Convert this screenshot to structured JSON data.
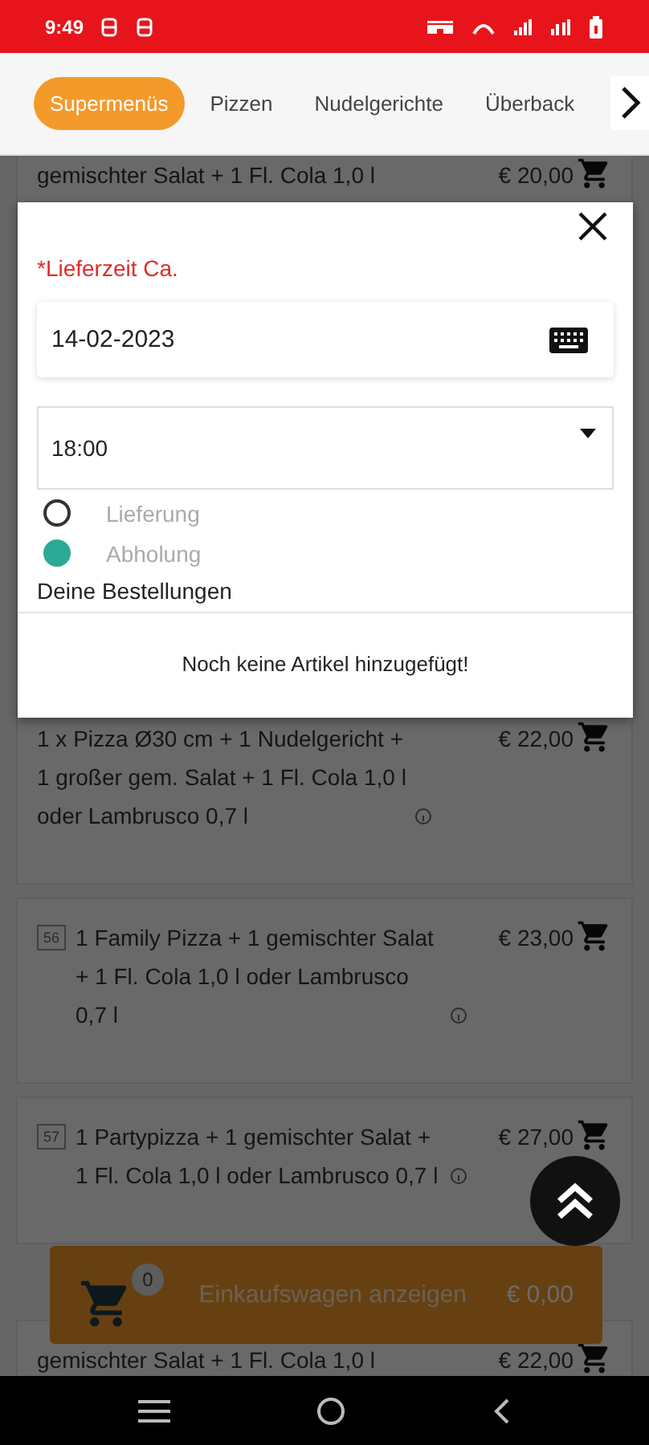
{
  "status_bar": {
    "time": "9:49"
  },
  "tabs": [
    {
      "label": "Supermenüs",
      "selected": true
    },
    {
      "label": "Pizzen",
      "selected": false
    },
    {
      "label": "Nudelgerichte",
      "selected": false
    },
    {
      "label": "Überback",
      "selected": false
    }
  ],
  "menu_items": [
    {
      "description": "gemischter Salat + 1 Fl. Cola 1,0 l",
      "price": "€ 20,00"
    },
    {
      "description": "1 x Pizza Ø30 cm + 1 Nudelgericht + 1 großer gem. Salat + 1 Fl. Cola 1,0 l oder Lambrusco 0,7 l",
      "price": "€ 22,00",
      "info": true
    },
    {
      "number": "56",
      "description": "1 Family Pizza + 1 gemischter Salat + 1 Fl. Cola 1,0 l oder Lambrusco 0,7 l",
      "price": "€ 23,00",
      "info": true
    },
    {
      "number": "57",
      "description": "1 Partypizza + 1 gemischter Salat + 1 Fl. Cola 1,0 l oder Lambrusco 0,7 l",
      "price": "€ 27,00",
      "info": true
    },
    {
      "description": "gemischter Salat + 1 Fl. Cola 1,0 l",
      "price": "€ 22,00"
    }
  ],
  "cart_bar": {
    "count": "0",
    "label": "Einkaufswagen anzeigen",
    "total": "€ 0,00"
  },
  "modal": {
    "label": "*Lieferzeit Ca.",
    "date": {
      "value": "14-02-2023"
    },
    "time": {
      "value": "18:00"
    },
    "options": [
      {
        "label": "Lieferung",
        "selected": false
      },
      {
        "label": "Abholung",
        "selected": true
      }
    ],
    "orders_heading": "Deine Bestellungen",
    "empty_message": "Noch keine Artikel hinzugefügt!"
  }
}
